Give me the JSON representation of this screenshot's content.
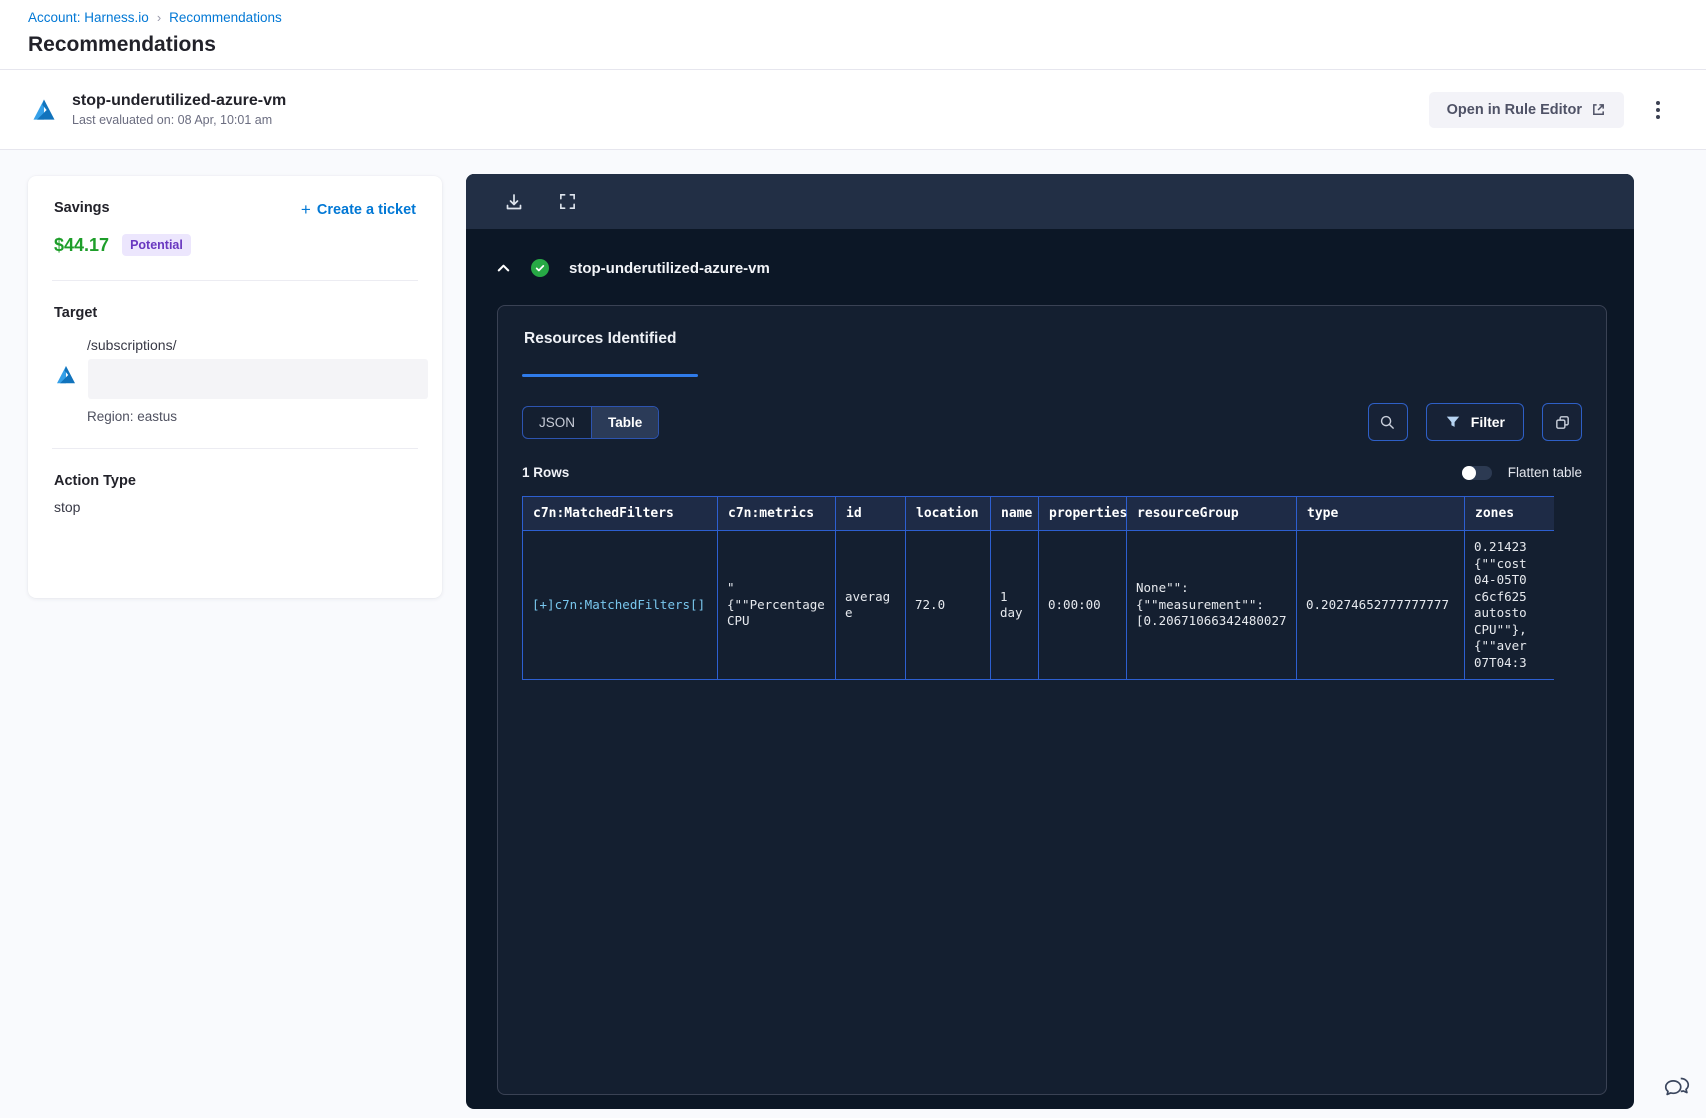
{
  "breadcrumb": {
    "account": "Account: Harness.io",
    "separator": "›",
    "current": "Recommendations"
  },
  "page_title": "Recommendations",
  "header": {
    "title": "stop-underutilized-azure-vm",
    "subtitle": "Last evaluated on: 08 Apr, 10:01 am",
    "open_rule_editor_label": "Open in Rule Editor",
    "kebab_menu": "more-options"
  },
  "savings_card": {
    "savings_label": "Savings",
    "amount": "$44.17",
    "badge": "Potential",
    "create_ticket_label": "Create a ticket",
    "target_label": "Target",
    "target_path": "/subscriptions/",
    "region": "Region: eastus",
    "action_type_label": "Action Type",
    "action_type_value": "stop"
  },
  "panel": {
    "title": "stop-underutilized-azure-vm",
    "tab_label": "Resources Identified",
    "view_toggle": {
      "json": "JSON",
      "table": "Table",
      "active": "Table"
    },
    "filter_label": "Filter",
    "rows_count": "1 Rows",
    "flatten_label": "Flatten table",
    "flatten_on": false,
    "table": {
      "columns": [
        "c7n:MatchedFilters",
        "c7n:metrics",
        "id",
        "location",
        "name",
        "properties",
        "resourceGroup",
        "type",
        "zones"
      ],
      "rows": [
        [
          "[+]c7n:MatchedFilters[]",
          "\"\n{\"\"Percentage CPU",
          "average",
          "72.0",
          "1 day",
          "0:00:00",
          "None\"\": {\"\"measurement\"\": [0.20671066342480027",
          "0.20274652777777777",
          "0.21423\n{\"\"cost\n04-05T0\nc6cf625\nautosto\nCPU\"\"},\n{\"\"aver\n07T04:3"
        ]
      ]
    }
  },
  "colors": {
    "brand_blue": "#0278d5",
    "savings_green": "#1e9e2a",
    "badge_purple_text": "#6938c0",
    "badge_purple_bg": "#ece6fd",
    "panel_bg": "#0c1726",
    "panel_toolbar_bg": "#222f45",
    "inner_card_bg": "#141f30",
    "table_border_blue": "#2d5fd0",
    "table_header_bg": "#1e2b46",
    "accent_tab_blue": "#2f7bea",
    "success_green": "#27a945"
  }
}
